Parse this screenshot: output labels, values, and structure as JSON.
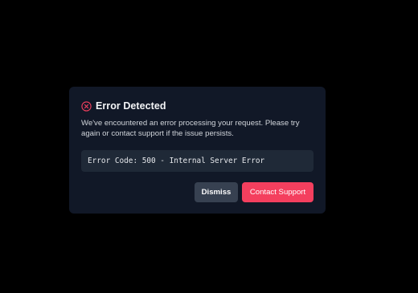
{
  "dialog": {
    "title": "Error Detected",
    "icon": "error-circle-x-icon",
    "message": "We've encountered an error processing your request. Please try again or contact support if the issue persists.",
    "code": "Error Code: 500 - Internal Server Error",
    "buttons": {
      "dismiss_label": "Dismiss",
      "contact_label": "Contact Support"
    }
  },
  "colors": {
    "backdrop": "#000000",
    "dialog_bg": "#111827",
    "code_bg": "#1f2937",
    "dismiss_bg": "#374151",
    "accent": "#f43f5e",
    "icon": "#f43f5e"
  }
}
